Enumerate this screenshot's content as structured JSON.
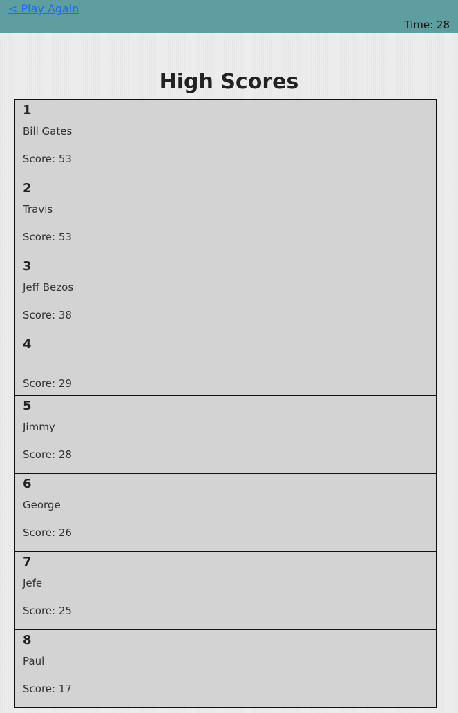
{
  "header": {
    "back_link": "< Play Again",
    "timer": "Time: 28",
    "background_color": "#5f9ea0",
    "link_color": "#1a6cf0"
  },
  "page": {
    "title": "High Scores"
  },
  "scores": [
    {
      "rank": "1",
      "name": "Bill Gates",
      "score": "Score: 53"
    },
    {
      "rank": "2",
      "name": "Travis",
      "score": "Score: 53"
    },
    {
      "rank": "3",
      "name": "Jeff Bezos",
      "score": "Score: 38"
    },
    {
      "rank": "4",
      "name": "",
      "score": "Score: 29"
    },
    {
      "rank": "5",
      "name": "Jimmy",
      "score": "Score: 28"
    },
    {
      "rank": "6",
      "name": "George",
      "score": "Score: 26"
    },
    {
      "rank": "7",
      "name": "Jefe",
      "score": "Score: 25"
    },
    {
      "rank": "8",
      "name": "Paul",
      "score": "Score: 17"
    }
  ]
}
